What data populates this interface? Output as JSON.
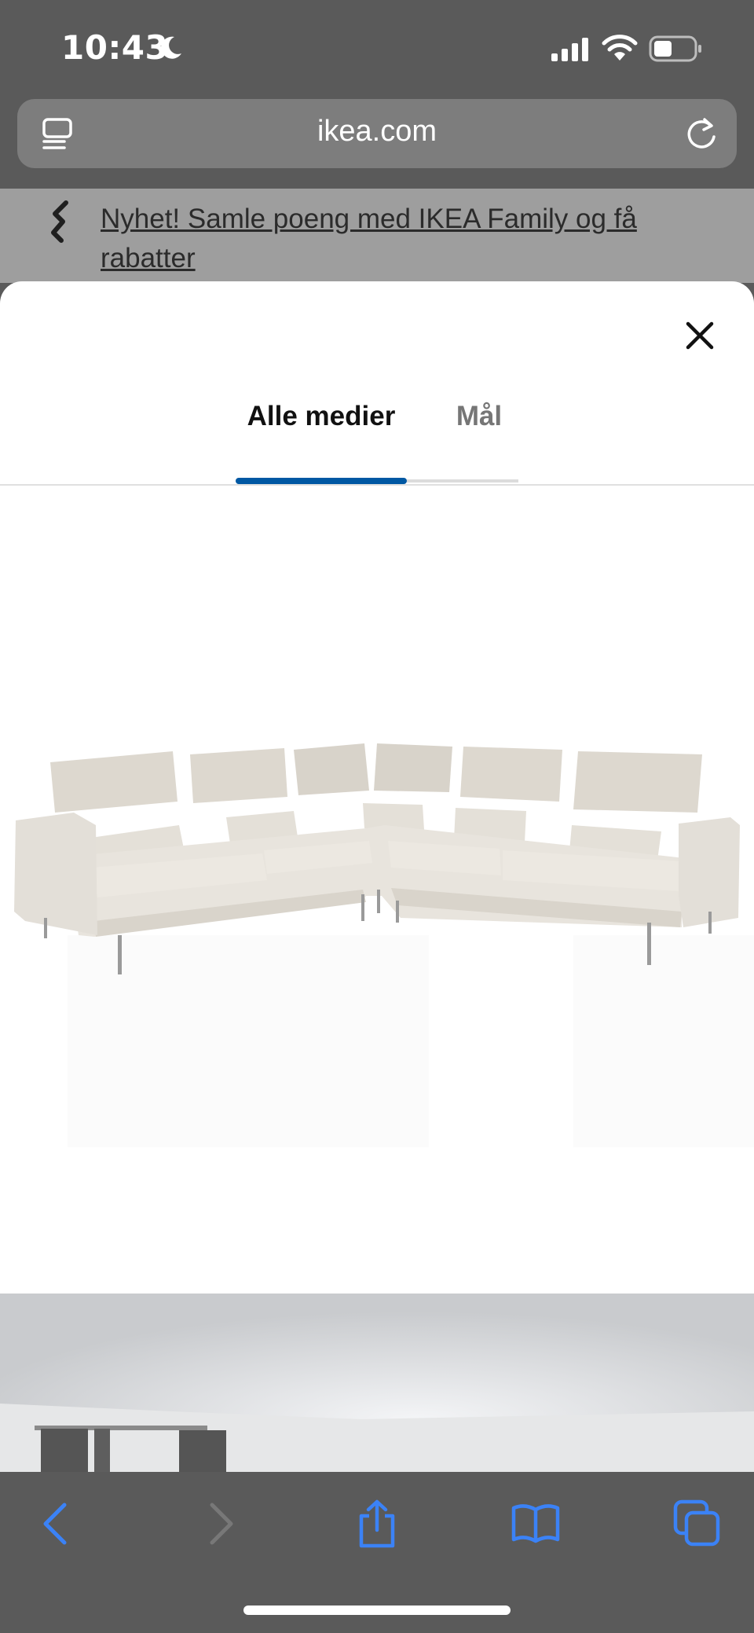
{
  "status_bar": {
    "time": "10:43"
  },
  "address_bar": {
    "url": "ikea.com"
  },
  "promo": {
    "text": "Nyhet! Samle poeng med IKEA Family og få rabatter"
  },
  "media_tabs": {
    "items": [
      {
        "label": "Alle medier",
        "selected": true
      },
      {
        "label": "Mål",
        "selected": false
      }
    ]
  },
  "colors": {
    "accent": "#0058a3",
    "toolbar_icons": "#3b82f6",
    "sofa": "#e6e2db"
  },
  "icons": [
    "moon-icon",
    "signal-icon",
    "wifi-icon",
    "battery-icon",
    "tab-overview-icon",
    "reload-icon",
    "ikea-family-icon",
    "close-icon",
    "back-icon",
    "forward-icon",
    "share-icon",
    "bookmarks-icon",
    "tabs-icon"
  ]
}
